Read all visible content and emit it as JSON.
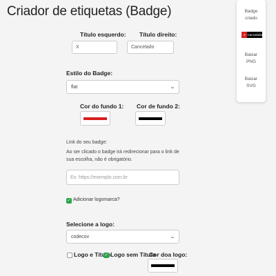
{
  "page": {
    "title": "Criador de etiquetas (Badge)"
  },
  "form": {
    "left_title": {
      "label": "Título esquerdo:",
      "value": "X"
    },
    "right_title": {
      "label": "Título direito:",
      "value": "Cancelado"
    },
    "style": {
      "label": "Estilo do Badge:",
      "selected": "flat"
    },
    "bg_color_1": {
      "label": "Cor do fundo 1:",
      "color": "#d81f1f"
    },
    "bg_color_2": {
      "label": "Cor de fundo 2:",
      "color": "#000000"
    },
    "link": {
      "label": "Link do seu badge:",
      "help": "Ao ser clicado o badge irá redirecionar para o link de sua escolha, não é obrigatório.",
      "placeholder": "Ex: https://exemplo.com.br"
    },
    "add_logo": {
      "label": "Adicionar logomarca?",
      "checked": true
    },
    "logo_select": {
      "label": "Selecione a logo:",
      "selected": "codecov"
    },
    "logo_options": [
      {
        "label": "Logo e Título",
        "checked": false
      },
      {
        "label": "Logo sem Título",
        "checked": true
      }
    ],
    "logo_color": {
      "label": "Cor doa logo:",
      "color": "#000000"
    }
  },
  "side_panel": {
    "created_label_line1": "Badge",
    "created_label_line2": "criado",
    "badge_left": "X",
    "badge_right": "Cancelado",
    "png_line1": "Baixar",
    "png_line2": "PNG",
    "svg_line1": "Baixar",
    "svg_line2": "SVG"
  },
  "icons": {
    "chevron": "chevron-down-icon",
    "check": "check-icon"
  }
}
